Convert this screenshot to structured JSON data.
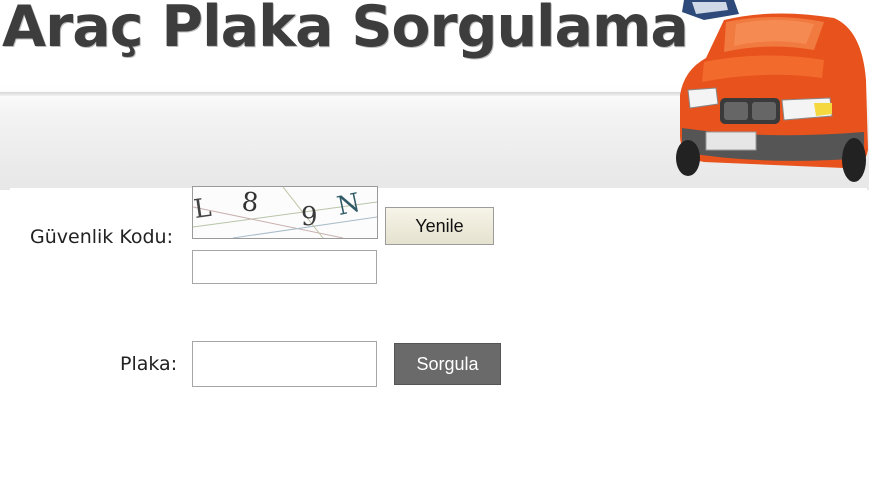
{
  "header": {
    "title": "Araç Plaka Sorgulama"
  },
  "form": {
    "security_label": "Güvenlik Kodu:",
    "captcha": {
      "chars": [
        "L",
        "8",
        "9",
        "N"
      ]
    },
    "refresh_button": "Yenile",
    "security_input_value": "",
    "plate_label": "Plaka:",
    "plate_input_value": "",
    "submit_button": "Sorgula"
  },
  "colors": {
    "title": "#3d3d3d",
    "car_body": "#e8521c",
    "submit_button_bg": "#6a6a6a",
    "refresh_button_bg": "#eeebd9"
  }
}
